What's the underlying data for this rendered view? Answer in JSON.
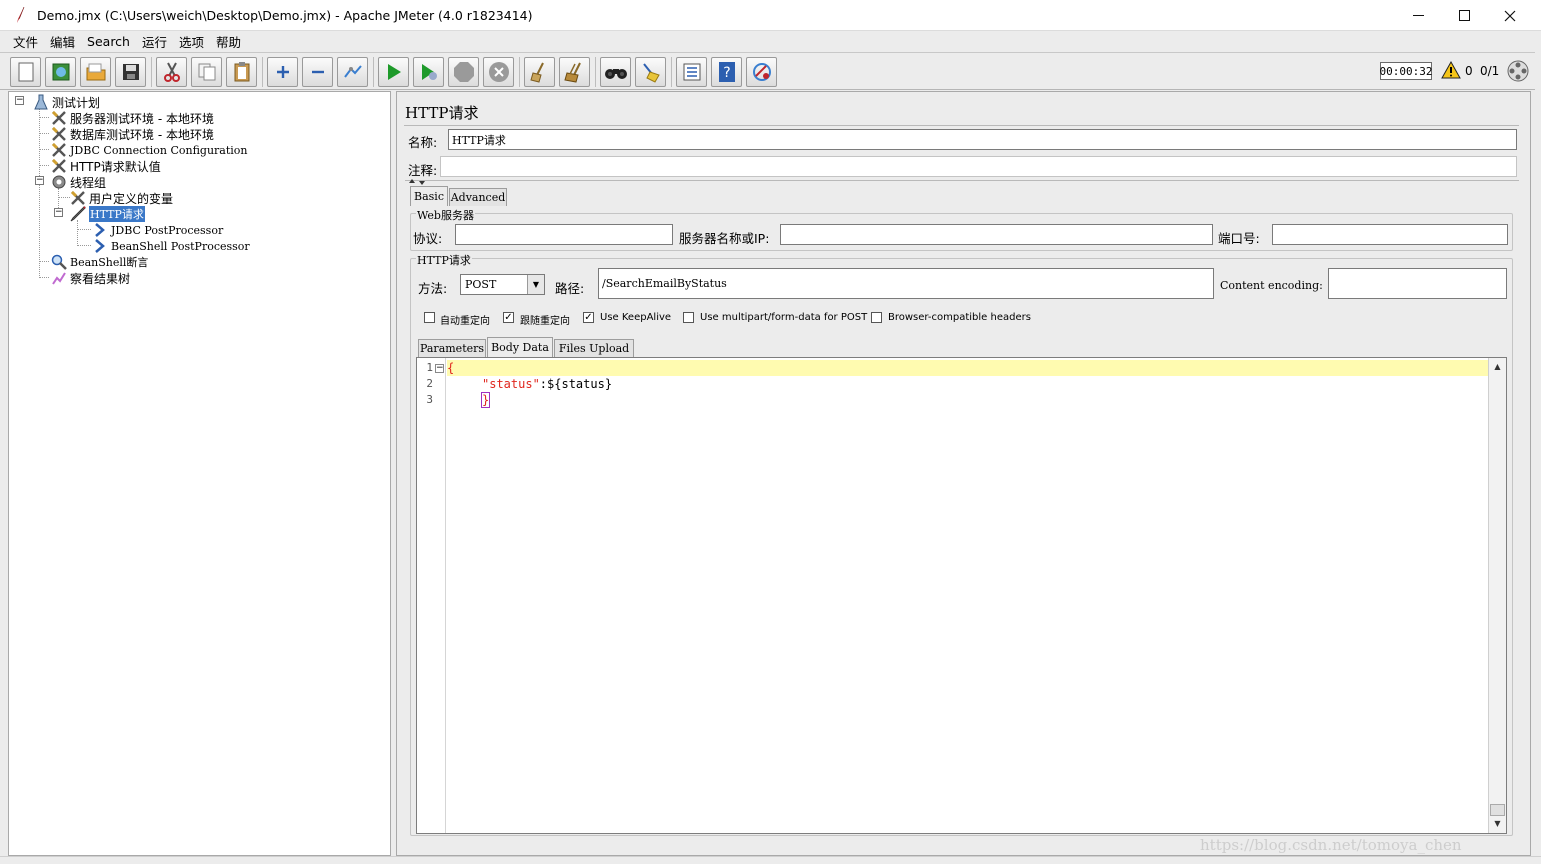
{
  "window": {
    "title": "Demo.jmx (C:\\Users\\weich\\Desktop\\Demo.jmx) - Apache JMeter (4.0 r1823414)"
  },
  "menu": [
    "文件",
    "编辑",
    "Search",
    "运行",
    "选项",
    "帮助"
  ],
  "toolbar": {
    "icons": [
      "new-icon",
      "templates-icon",
      "open-icon",
      "save-icon",
      "cut-icon",
      "copy-icon",
      "paste-icon",
      "expand-icon",
      "collapse-icon",
      "toggle-icon",
      "start-icon",
      "start-no-pause-icon",
      "stop-icon",
      "shutdown-icon",
      "clear-icon",
      "clear-all-icon",
      "search-icon",
      "reset-search-icon",
      "function-helper-icon",
      "help-icon",
      "remote-icon"
    ],
    "timer": "00:00:32",
    "warning_count": "0",
    "threads": "0/1"
  },
  "tree": {
    "root": "测试计划",
    "items": [
      {
        "label": "服务器测试环境 - 本地环境"
      },
      {
        "label": "数据库测试环境 - 本地环境"
      },
      {
        "label": "JDBC Connection Configuration"
      },
      {
        "label": "HTTP请求默认值"
      },
      {
        "label": "线程组"
      },
      {
        "label": "用户定义的变量"
      },
      {
        "label": "HTTP请求"
      },
      {
        "label": "JDBC PostProcessor"
      },
      {
        "label": "BeanShell PostProcessor"
      },
      {
        "label": "BeanShell断言"
      },
      {
        "label": "察看结果树"
      }
    ]
  },
  "panel": {
    "title": "HTTP请求",
    "name_label": "名称:",
    "name_value": "HTTP请求",
    "comment_label": "注释:",
    "tabs": [
      "Basic",
      "Advanced"
    ],
    "web_server": {
      "title": "Web服务器",
      "protocol_label": "协议:",
      "protocol_value": "",
      "server_label": "服务器名称或IP:",
      "server_value": "",
      "port_label": "端口号:",
      "port_value": ""
    },
    "http_request": {
      "title": "HTTP请求",
      "method_label": "方法:",
      "method_value": "POST",
      "path_label": "路径:",
      "path_value": "/SearchEmailByStatus",
      "encoding_label": "Content encoding:",
      "encoding_value": ""
    },
    "checkboxes": [
      {
        "label": "自动重定向",
        "checked": false
      },
      {
        "label": "跟随重定向",
        "checked": true
      },
      {
        "label": "Use KeepAlive",
        "checked": true
      },
      {
        "label": "Use multipart/form-data for POST",
        "checked": false
      },
      {
        "label": "Browser-compatible headers",
        "checked": false
      }
    ],
    "sub_tabs": [
      "Parameters",
      "Body Data",
      "Files Upload"
    ],
    "body": {
      "line_numbers": [
        "1",
        "2",
        "3"
      ],
      "line1": "{",
      "line2_key": "\"status\"",
      "line2_colon": ":",
      "line2_value": "${status}",
      "line3": "}"
    }
  },
  "watermark": "https://blog.csdn.net/tomoya_chen"
}
